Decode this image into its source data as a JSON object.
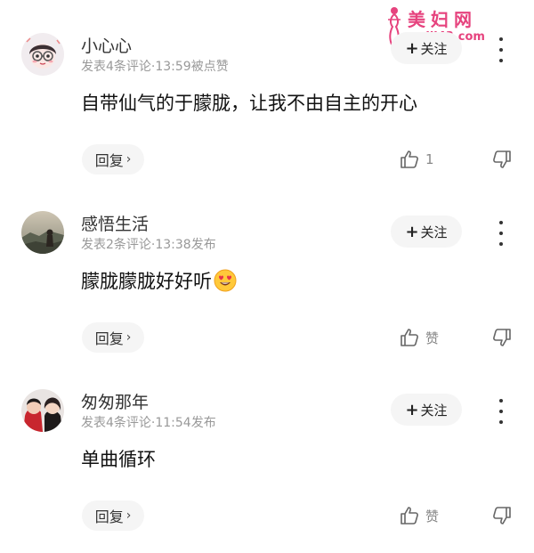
{
  "watermark": {
    "title": "美妇网",
    "url": "meili43.com",
    "color": "#e6437e"
  },
  "comments": [
    {
      "username": "小心心",
      "meta": "发表4条评论·13:59被点赞",
      "follow_label": "关注",
      "content": "自带仙气的于朦胧，让我不由自主的开心",
      "has_emoji": false,
      "reply_label": "回复",
      "like_text": "1",
      "avatar_icon": "cartoon-girl-avatar"
    },
    {
      "username": "感悟生活",
      "meta": "发表2条评论·13:38发布",
      "follow_label": "关注",
      "content": "朦胧朦胧好好听",
      "has_emoji": true,
      "emoji_icon": "heart-eyes-emoji-icon",
      "reply_label": "回复",
      "like_text": "赞",
      "avatar_icon": "landscape-avatar"
    },
    {
      "username": "匆匆那年",
      "meta": "发表4条评论·11:54发布",
      "follow_label": "关注",
      "content": "单曲循环",
      "has_emoji": false,
      "reply_label": "回复",
      "like_text": "赞",
      "avatar_icon": "couple-photo-avatar"
    }
  ]
}
